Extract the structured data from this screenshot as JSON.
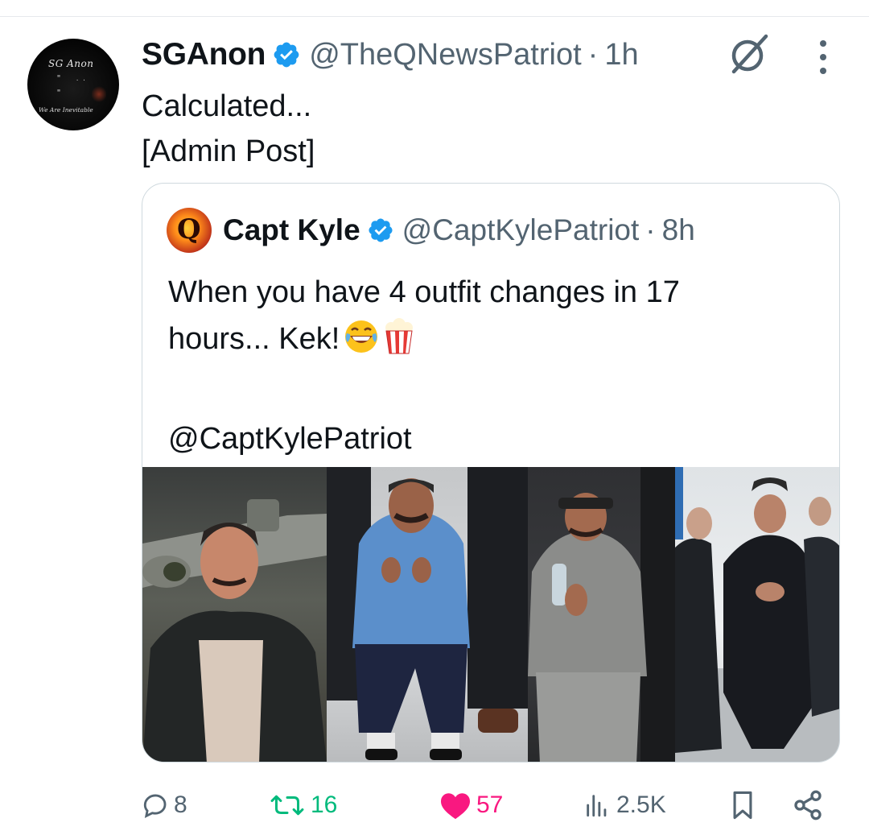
{
  "post": {
    "author_name": "SGAnon",
    "author_handle": "@TheQNewsPatriot",
    "separator": "·",
    "time": "1h",
    "avatar_text": "SG Anon",
    "avatar_subtext": "We Are Inevitable",
    "body_lines": [
      "Calculated...",
      "[Admin Post]"
    ]
  },
  "quote": {
    "author_name": "Capt Kyle",
    "author_handle": "@CaptKylePatriot",
    "separator": "·",
    "time": "8h",
    "avatar_letter": "Q",
    "text_line1": "When you have 4 outfit changes in 17",
    "text_line2": "hours... Kek!",
    "emojis": [
      "face-with-tears-of-joy",
      "popcorn"
    ],
    "text_mention": "@CaptKylePatriot",
    "photo_count": 4
  },
  "actions": {
    "replies": "8",
    "reposts": "16",
    "likes": "57",
    "views": "2.5K"
  },
  "colors": {
    "text": "#0f1419",
    "secondary": "#536471",
    "verified": "#1d9bf0",
    "repost": "#00ba7c",
    "like": "#f91880",
    "border": "#cfd9de"
  },
  "icons": [
    "verified-badge-icon",
    "grok-icon",
    "more-icon",
    "reply-icon",
    "repost-icon",
    "like-icon",
    "views-icon",
    "bookmark-icon",
    "share-icon"
  ]
}
